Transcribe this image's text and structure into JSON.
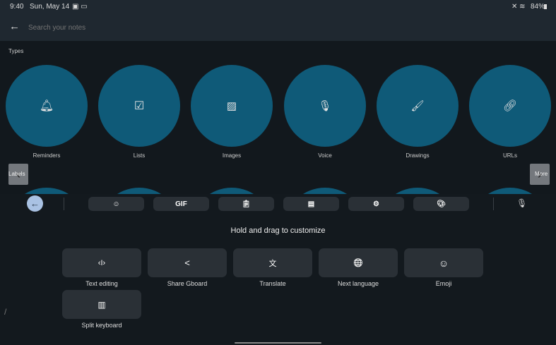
{
  "status": {
    "time": "9:40",
    "date": "Sun, May 14",
    "battery": "84%"
  },
  "search": {
    "placeholder": "Search your notes"
  },
  "types": {
    "heading": "Types",
    "items": [
      {
        "label": "Reminders",
        "icon": "bell-icon"
      },
      {
        "label": "Lists",
        "icon": "checkbox-icon"
      },
      {
        "label": "Images",
        "icon": "image-icon"
      },
      {
        "label": "Voice",
        "icon": "mic-icon"
      },
      {
        "label": "Drawings",
        "icon": "brush-icon"
      },
      {
        "label": "URLs",
        "icon": "link-icon"
      }
    ]
  },
  "labels": {
    "heading": "Labels",
    "more": "More"
  },
  "keyboard": {
    "toolbar": [
      {
        "icon": "sticker-icon",
        "text": ""
      },
      {
        "icon": "gif-icon",
        "text": "GIF"
      },
      {
        "icon": "clipboard-icon",
        "text": ""
      },
      {
        "icon": "keyboard-icon",
        "text": ""
      },
      {
        "icon": "gear-icon",
        "text": ""
      },
      {
        "icon": "palette-icon",
        "text": ""
      }
    ],
    "hint": "Hold and drag to customize",
    "tiles": [
      {
        "label": "Text editing",
        "icon": "text-cursor-icon",
        "glyph": "‹I›"
      },
      {
        "label": "Share Gboard",
        "icon": "share-icon",
        "glyph": "<"
      },
      {
        "label": "Translate",
        "icon": "translate-icon",
        "glyph": "文"
      },
      {
        "label": "Next language",
        "icon": "globe-icon",
        "glyph": "🌐"
      },
      {
        "label": "Emoji",
        "icon": "emoji-icon",
        "glyph": "☺"
      },
      {
        "label": "Split keyboard",
        "icon": "split-keyboard-icon",
        "glyph": "▥"
      }
    ]
  }
}
